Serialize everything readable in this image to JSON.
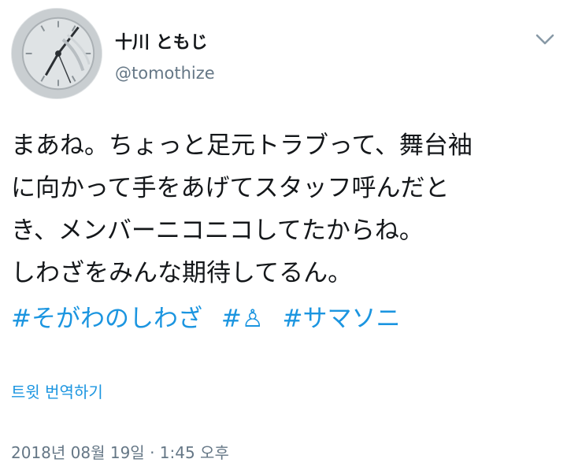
{
  "user": {
    "display_name": "十川 ともじ",
    "handle": "@tomothize",
    "avatar_icon": "clock-avatar-icon"
  },
  "menu": {
    "icon": "chevron-down-icon"
  },
  "tweet": {
    "lines": [
      "まあね。ちょっと足元トラブって、舞台袖",
      "に向かって手をあげてスタッフ呼んだと",
      "き、メンバーニコニコしてたからね。",
      "しわざをみんな期待してるん。"
    ],
    "hashtags": [
      "#そがわのしわざ",
      "#♙",
      "#サマソニ"
    ]
  },
  "translate_label": "트윗 번역하기",
  "timestamp": "2018년 08월 19일 · 1:45 오후",
  "colors": {
    "text": "#14171a",
    "secondary": "#657786",
    "link": "#1b95e0"
  }
}
